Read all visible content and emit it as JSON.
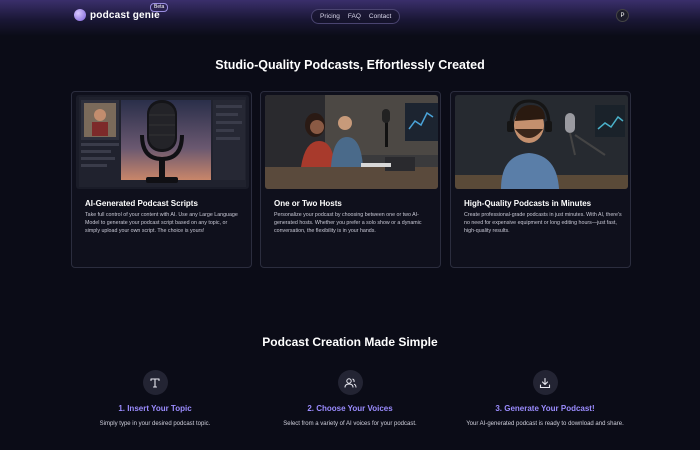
{
  "header": {
    "logo_text": "podcast genie",
    "beta_label": "Beta",
    "nav": [
      "Pricing",
      "FAQ",
      "Contact"
    ],
    "avatar_initial": "P"
  },
  "hero": {
    "title": "Studio-Quality Podcasts, Effortlessly Created"
  },
  "features": [
    {
      "title": "AI-Generated Podcast Scripts",
      "description": "Take full control of your content with AI. Use any Large Language Model to generate your podcast script based on any topic, or simply upload your own script. The choice is yours!"
    },
    {
      "title": "One or Two Hosts",
      "description": "Personalize your podcast by choosing between one or two AI-generated hosts. Whether you prefer a solo show or a dynamic conversation, the flexibility is in your hands."
    },
    {
      "title": "High-Quality Podcasts in Minutes",
      "description": "Create professional-grade podcasts in just minutes. With AI, there's no need for expensive equipment or long editing hours—just fast, high-quality results."
    }
  ],
  "how_it_works": {
    "title": "Podcast Creation Made Simple",
    "steps": [
      {
        "icon": "text-icon",
        "title": "1. Insert Your Topic",
        "description": "Simply type in your desired podcast topic."
      },
      {
        "icon": "users-icon",
        "title": "2. Choose Your Voices",
        "description": "Select from a variety of AI voices for your podcast."
      },
      {
        "icon": "download-icon",
        "title": "3. Generate Your Podcast!",
        "description": "Your AI-generated podcast is ready to download and share."
      }
    ]
  },
  "colors": {
    "background": "#0b0c17",
    "accent": "#9b8cff",
    "card_border": "#2b2d3e"
  }
}
